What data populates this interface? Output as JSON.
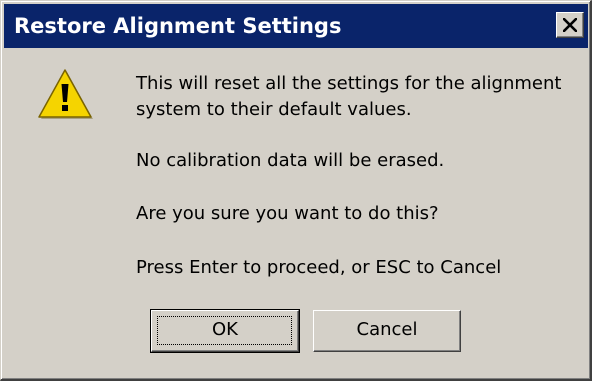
{
  "dialog": {
    "title": "Restore Alignment Settings",
    "close_label": "×"
  },
  "icon": {
    "name": "warning-icon",
    "colors": {
      "fill": "#f5d400",
      "outline": "#7a6400",
      "mark": "#000000"
    }
  },
  "message": {
    "line1": "This will reset all the settings for the alignment",
    "line2": "system to their default values.",
    "line3": "No calibration data will be erased.",
    "line4": "Are you sure you want to do this?",
    "line5": "Press Enter to proceed, or ESC to Cancel"
  },
  "buttons": {
    "ok_label": "OK",
    "cancel_label": "Cancel"
  },
  "colors": {
    "titlebar": "#0a246a",
    "face": "#d4d0c8"
  }
}
